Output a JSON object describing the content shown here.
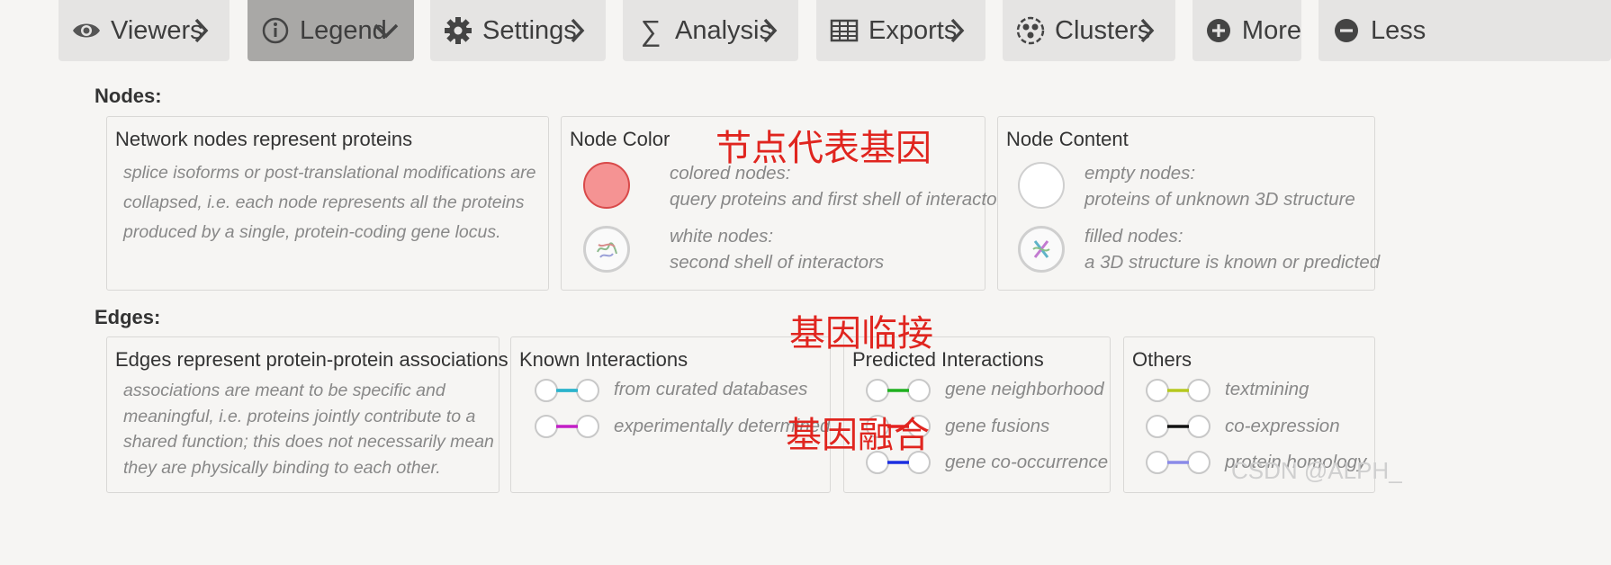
{
  "toolbar": {
    "buttons": [
      {
        "label": "Viewers",
        "icon": "eye-icon",
        "chevron": "right"
      },
      {
        "label": "Legend",
        "icon": "info-circle-icon",
        "chevron": "down",
        "active": true
      },
      {
        "label": "Settings",
        "icon": "gear-icon",
        "chevron": "right"
      },
      {
        "label": "Analysis",
        "icon": "sigma-icon",
        "chevron": "right"
      },
      {
        "label": "Exports",
        "icon": "table-icon",
        "chevron": "right"
      },
      {
        "label": "Clusters",
        "icon": "clusters-icon",
        "chevron": "right"
      },
      {
        "label": "More",
        "icon": "plus-circle-icon"
      },
      {
        "label": "Less",
        "icon": "minus-circle-icon"
      }
    ]
  },
  "nodes": {
    "title": "Nodes:",
    "panels": {
      "representation": {
        "title": "Network nodes represent proteins",
        "desc": [
          "splice isoforms or post-translational modifications are",
          "collapsed, i.e. each node represents all the proteins",
          "produced by a single, protein-coding gene locus."
        ]
      },
      "color": {
        "title": "Node Color",
        "items": [
          {
            "icon": "colored-node-icon",
            "line1": "colored nodes:",
            "line2": "query proteins and first shell of interactors"
          },
          {
            "icon": "white-node-icon",
            "line1": "white nodes:",
            "line2": "second shell of interactors"
          }
        ]
      },
      "content": {
        "title": "Node Content",
        "items": [
          {
            "icon": "empty-node-icon",
            "line1": "empty nodes:",
            "line2": "proteins of unknown 3D structure"
          },
          {
            "icon": "filled-node-icon",
            "line1": "filled nodes:",
            "line2": "a 3D structure is known or predicted"
          }
        ]
      }
    }
  },
  "edges": {
    "title": "Edges:",
    "panels": {
      "representation": {
        "title": "Edges represent protein-protein associations",
        "desc": [
          "associations are meant to be specific and",
          "meaningful, i.e. proteins jointly contribute to a",
          "shared function; this does not necessarily mean",
          "they are physically binding to each other."
        ]
      },
      "known": {
        "title": "Known Interactions",
        "items": [
          {
            "label": "from curated databases",
            "color": "#2bb3cc"
          },
          {
            "label": "experimentally determined",
            "color": "#c21fc6"
          }
        ]
      },
      "predicted": {
        "title": "Predicted Interactions",
        "items": [
          {
            "label": "gene neighborhood",
            "color": "#1fb01f"
          },
          {
            "label": "gene fusions",
            "color": "#e52020"
          },
          {
            "label": "gene co-occurrence",
            "color": "#1b2ee0"
          }
        ]
      },
      "others": {
        "title": "Others",
        "items": [
          {
            "label": "textmining",
            "color": "#b5c81e"
          },
          {
            "label": "co-expression",
            "color": "#111111"
          },
          {
            "label": "protein homology",
            "color": "#8a8ae8"
          }
        ]
      }
    }
  },
  "annotations": {
    "node_note": "节点代表基因",
    "neighborhood_note": "基因临接",
    "fusion_note": "基因融合"
  },
  "watermark": "CSDN @ALPH_",
  "colors": {
    "toolbar_bg": "#e5e4e3",
    "toolbar_active": "#a9a8a6",
    "colored_node_fill": "#f59393",
    "colored_node_border": "#d94a4a",
    "annotation": "#e0251f"
  }
}
